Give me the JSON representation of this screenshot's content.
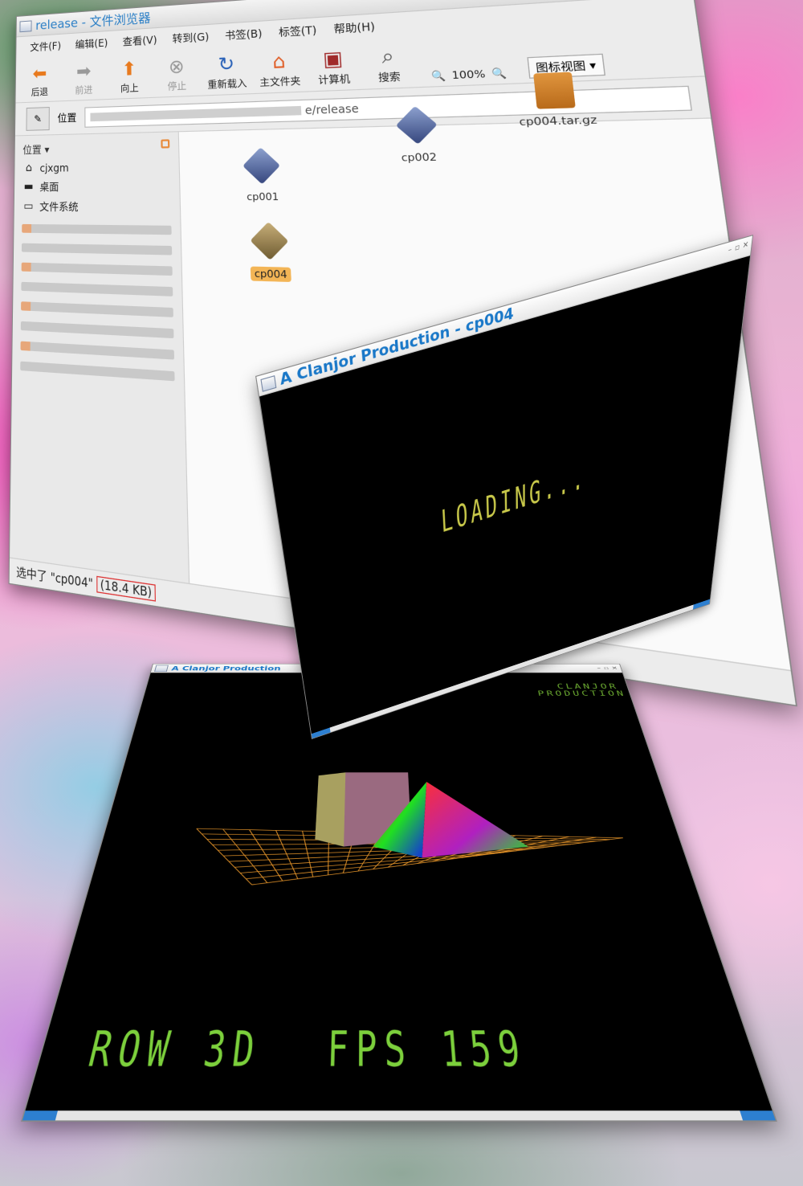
{
  "file_browser": {
    "title": "release - 文件浏览器",
    "menu": [
      "文件(F)",
      "编辑(E)",
      "查看(V)",
      "转到(G)",
      "书签(B)",
      "标签(T)",
      "帮助(H)"
    ],
    "toolbar": {
      "back": "后退",
      "forward": "前进",
      "up": "向上",
      "stop": "停止",
      "reload": "重新载入",
      "home": "主文件夹",
      "computer": "计算机",
      "search": "搜索",
      "zoom": "100%",
      "view_mode": "图标视图"
    },
    "location_label": "位置",
    "location_path": "e/release",
    "sidebar": {
      "header": "位置",
      "items": [
        {
          "label": "cjxgm",
          "icon": "home-icon"
        },
        {
          "label": "桌面",
          "icon": "desktop-icon"
        },
        {
          "label": "文件系统",
          "icon": "drive-icon"
        }
      ]
    },
    "files": [
      {
        "name": "cp001",
        "type": "executable"
      },
      {
        "name": "cp002",
        "type": "executable"
      },
      {
        "name": "cp004.tar.gz",
        "type": "archive"
      },
      {
        "name": "cp004",
        "type": "executable",
        "selected": true
      }
    ],
    "status": {
      "text": "选中了 \"cp004\"",
      "size": "(18.4 KB)"
    }
  },
  "loading_window": {
    "title": "A Clanjor Production - cp004",
    "text": "LOADING..."
  },
  "game_window": {
    "title": "A Clanjor Production",
    "brand_line1": "CLANJOR",
    "brand_line2": "PRODUCTION",
    "hud_left": "ROW 3D",
    "hud_fps_label": "FPS",
    "hud_fps_value": "159"
  },
  "colors": {
    "title_blue": "#1a78c8",
    "grid_orange": "#e8962a",
    "hud_green": "#7cd03c",
    "loading_yellow": "#c8c84a"
  }
}
